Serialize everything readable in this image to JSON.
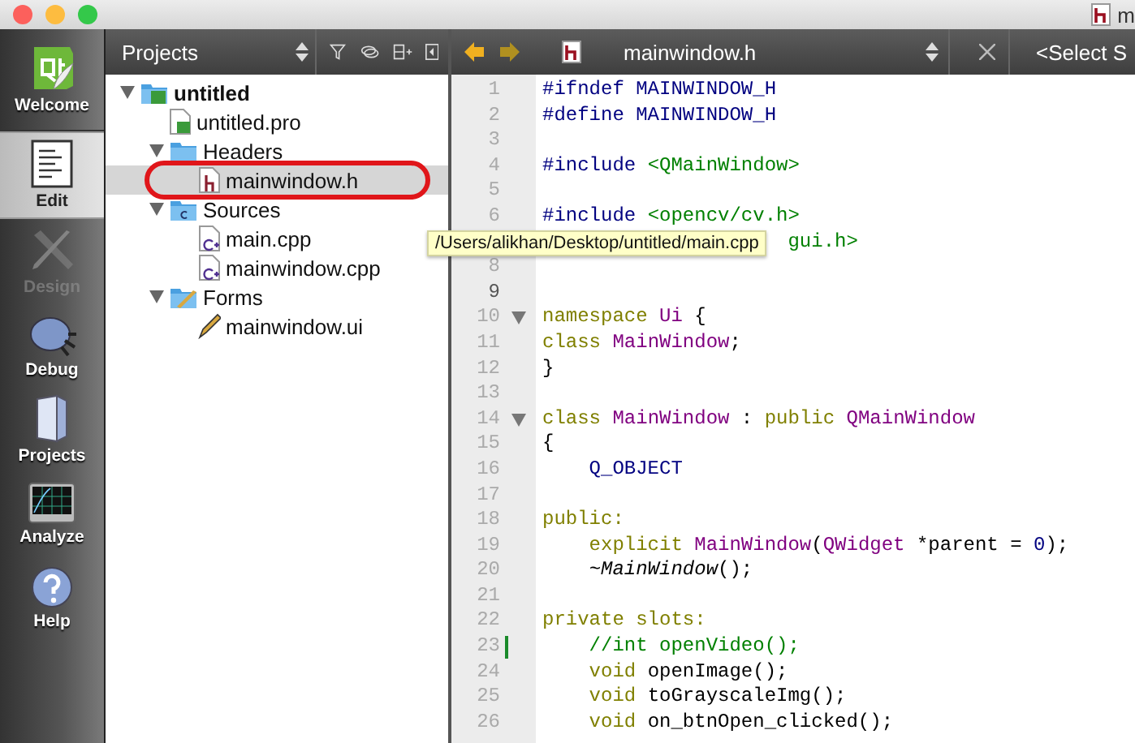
{
  "window": {
    "title": "m"
  },
  "mode_bar": {
    "items": [
      {
        "label": "Welcome",
        "kind": "welcome",
        "selected": false,
        "disabled": false
      },
      {
        "label": "Edit",
        "kind": "edit",
        "selected": true,
        "disabled": false
      },
      {
        "label": "Design",
        "kind": "design",
        "selected": false,
        "disabled": true
      },
      {
        "label": "Debug",
        "kind": "debug",
        "selected": false,
        "disabled": false
      },
      {
        "label": "Projects",
        "kind": "projects",
        "selected": false,
        "disabled": false
      },
      {
        "label": "Analyze",
        "kind": "analyze",
        "selected": false,
        "disabled": false
      },
      {
        "label": "Help",
        "kind": "help",
        "selected": false,
        "disabled": false
      }
    ]
  },
  "projects_panel": {
    "title": "Projects",
    "tree": [
      {
        "label": "untitled",
        "kind": "project",
        "expanded": true,
        "selected": false,
        "children": [
          {
            "label": "untitled.pro",
            "kind": "pro",
            "selected": false
          },
          {
            "label": "Headers",
            "kind": "folder-h",
            "expanded": true,
            "selected": false,
            "children": [
              {
                "label": "mainwindow.h",
                "kind": "header",
                "selected": true
              }
            ]
          },
          {
            "label": "Sources",
            "kind": "folder-cpp",
            "expanded": true,
            "selected": false,
            "children": [
              {
                "label": "main.cpp",
                "kind": "cpp",
                "selected": false
              },
              {
                "label": "mainwindow.cpp",
                "kind": "cpp",
                "selected": false
              }
            ]
          },
          {
            "label": "Forms",
            "kind": "folder-forms",
            "expanded": true,
            "selected": false,
            "children": [
              {
                "label": "mainwindow.ui",
                "kind": "ui",
                "selected": false
              }
            ]
          }
        ]
      }
    ],
    "tooltip": "/Users/alikhan/Desktop/untitled/main.cpp"
  },
  "editor": {
    "file": "mainwindow.h",
    "symbol_selector": "<Select S",
    "lines": [
      {
        "number": "1",
        "tokens": [
          {
            "text": "#ifndef MAINWINDOW_H",
            "kind": "preproc"
          }
        ]
      },
      {
        "number": "2",
        "tokens": [
          {
            "text": "#define MAINWINDOW_H",
            "kind": "preproc"
          }
        ]
      },
      {
        "number": "3"
      },
      {
        "number": "4",
        "tokens": [
          {
            "text": "#include ",
            "kind": "preproc"
          },
          {
            "text": "<QMainWindow>",
            "kind": "string"
          }
        ]
      },
      {
        "number": "5"
      },
      {
        "number": "6",
        "tokens": [
          {
            "text": "#include ",
            "kind": "preproc"
          },
          {
            "text": "<opencv/cv.h>",
            "kind": "string"
          }
        ]
      },
      {
        "covered": true,
        "tokens": [
          {
            "text": "gui.h>",
            "kind": "string"
          }
        ]
      },
      {
        "number": "8"
      },
      {
        "number": "9",
        "current": true
      },
      {
        "number": "10",
        "foldable": true,
        "tokens": [
          {
            "text": "namespace ",
            "kind": "keyword"
          },
          {
            "text": "Ui",
            "kind": "type"
          },
          {
            "text": " {",
            "kind": "plain"
          }
        ]
      },
      {
        "number": "11",
        "tokens": [
          {
            "text": "class ",
            "kind": "keyword"
          },
          {
            "text": "MainWindow",
            "kind": "type"
          },
          {
            "text": ";",
            "kind": "plain"
          }
        ]
      },
      {
        "number": "12",
        "tokens": [
          {
            "text": "}",
            "kind": "plain"
          }
        ]
      },
      {
        "number": "13"
      },
      {
        "number": "14",
        "foldable": true,
        "tokens": [
          {
            "text": "class ",
            "kind": "keyword"
          },
          {
            "text": "MainWindow",
            "kind": "type"
          },
          {
            "text": " : ",
            "kind": "plain"
          },
          {
            "text": "public ",
            "kind": "keyword"
          },
          {
            "text": "QMainWindow",
            "kind": "type"
          }
        ]
      },
      {
        "number": "15",
        "tokens": [
          {
            "text": "{",
            "kind": "plain"
          }
        ]
      },
      {
        "number": "16",
        "tokens": [
          {
            "text": "    Q_OBJECT",
            "kind": "preproc"
          }
        ]
      },
      {
        "number": "17"
      },
      {
        "number": "18",
        "tokens": [
          {
            "text": "public:",
            "kind": "keyword"
          }
        ]
      },
      {
        "number": "19",
        "tokens": [
          {
            "text": "    explicit ",
            "kind": "keyword"
          },
          {
            "text": "MainWindow",
            "kind": "type"
          },
          {
            "text": "(",
            "kind": "plain"
          },
          {
            "text": "QWidget",
            "kind": "type"
          },
          {
            "text": " *parent = ",
            "kind": "plain"
          },
          {
            "text": "0",
            "kind": "number"
          },
          {
            "text": ");",
            "kind": "plain"
          }
        ]
      },
      {
        "number": "20",
        "tokens": [
          {
            "text": "    ~MainWindow",
            "kind": "italic"
          },
          {
            "text": "();",
            "kind": "plain"
          }
        ]
      },
      {
        "number": "21"
      },
      {
        "number": "22",
        "tokens": [
          {
            "text": "private slots:",
            "kind": "keyword"
          }
        ]
      },
      {
        "number": "23",
        "changed": true,
        "tokens": [
          {
            "text": "    //int openVideo();",
            "kind": "comment"
          }
        ]
      },
      {
        "number": "24",
        "tokens": [
          {
            "text": "    void ",
            "kind": "keyword"
          },
          {
            "text": "openImage();",
            "kind": "plain"
          }
        ]
      },
      {
        "number": "25",
        "tokens": [
          {
            "text": "    void ",
            "kind": "keyword"
          },
          {
            "text": "toGrayscaleImg();",
            "kind": "plain"
          }
        ]
      },
      {
        "number": "26",
        "tokens": [
          {
            "text": "    void ",
            "kind": "keyword"
          },
          {
            "text": "on_btnOpen_clicked();",
            "kind": "plain"
          }
        ]
      }
    ]
  }
}
